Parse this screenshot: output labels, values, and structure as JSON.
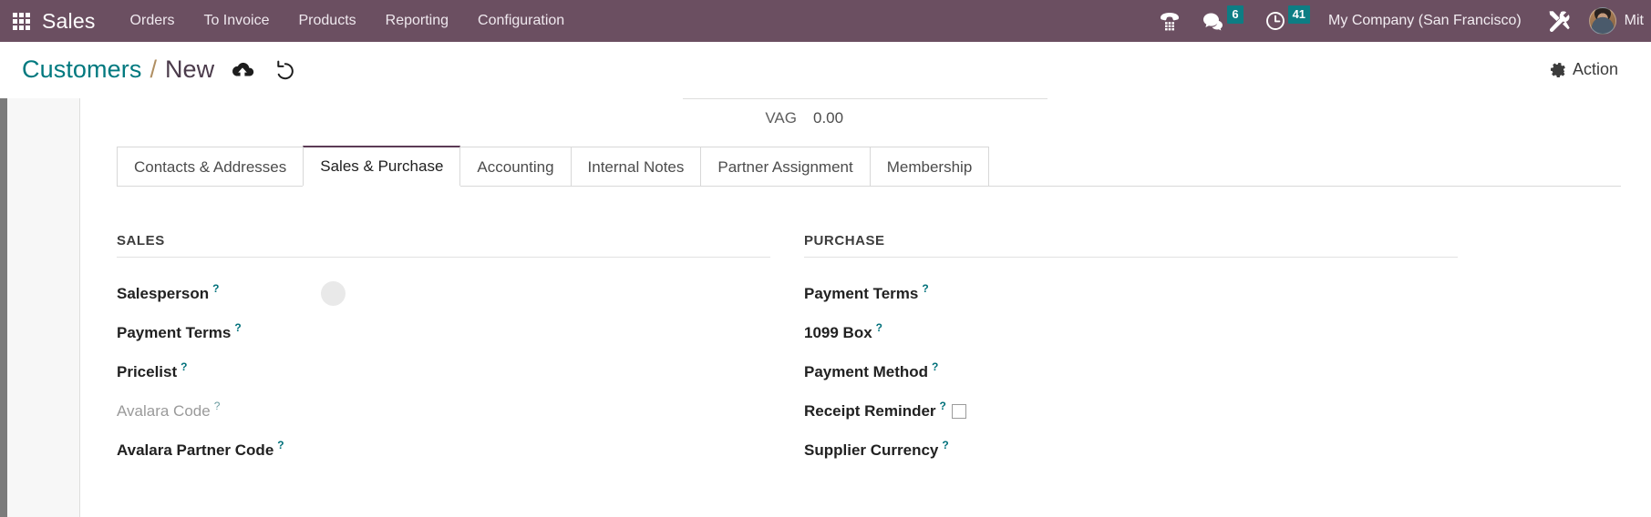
{
  "navbar": {
    "apps_icon": "apps-grid-icon",
    "brand": "Sales",
    "menu": [
      {
        "label": "Orders"
      },
      {
        "label": "To Invoice"
      },
      {
        "label": "Products"
      },
      {
        "label": "Reporting"
      },
      {
        "label": "Configuration"
      }
    ],
    "voip_icon": "phone-keypad-icon",
    "messages": {
      "icon": "chat-bubble-icon",
      "count": "6"
    },
    "activities": {
      "icon": "clock-icon",
      "count": "41"
    },
    "company": "My Company (San Francisco)",
    "tools_icon": "wrench-screwdriver-icon",
    "user": {
      "avatar": "user-avatar",
      "name": "Mit"
    },
    "accent_color": "#6b4f61",
    "badge_color": "#0d7d84"
  },
  "control_panel": {
    "breadcrumb": {
      "parent": "Customers",
      "separator": "/",
      "current": "New"
    },
    "save_icon": "cloud-upload-icon",
    "discard_icon": "undo-icon",
    "action": {
      "icon": "gear-icon",
      "label": "Action"
    }
  },
  "form": {
    "top_field": {
      "label": "VAG",
      "value": "0.00"
    },
    "tabs": [
      {
        "label": "Contacts & Addresses",
        "active": false
      },
      {
        "label": "Sales & Purchase",
        "active": true
      },
      {
        "label": "Accounting",
        "active": false
      },
      {
        "label": "Internal Notes",
        "active": false
      },
      {
        "label": "Partner Assignment",
        "active": false
      },
      {
        "label": "Membership",
        "active": false
      }
    ],
    "sales": {
      "title": "SALES",
      "fields": [
        {
          "label": "Salesperson",
          "help": "?",
          "value": "",
          "widget": "avatar"
        },
        {
          "label": "Payment Terms",
          "help": "?",
          "value": "",
          "widget": "text"
        },
        {
          "label": "Pricelist",
          "help": "?",
          "value": "",
          "widget": "text"
        },
        {
          "label": "Avalara Code",
          "help": "?",
          "value": "",
          "widget": "text",
          "muted": true
        },
        {
          "label": "Avalara Partner Code",
          "help": "?",
          "value": "",
          "widget": "text"
        }
      ]
    },
    "purchase": {
      "title": "PURCHASE",
      "fields": [
        {
          "label": "Payment Terms",
          "help": "?",
          "value": "",
          "widget": "text"
        },
        {
          "label": "1099 Box",
          "help": "?",
          "value": "",
          "widget": "text"
        },
        {
          "label": "Payment Method",
          "help": "?",
          "value": "",
          "widget": "text"
        },
        {
          "label": "Receipt Reminder",
          "help": "?",
          "value": "",
          "widget": "checkbox"
        },
        {
          "label": "Supplier Currency",
          "help": "?",
          "value": "",
          "widget": "text"
        }
      ]
    }
  }
}
